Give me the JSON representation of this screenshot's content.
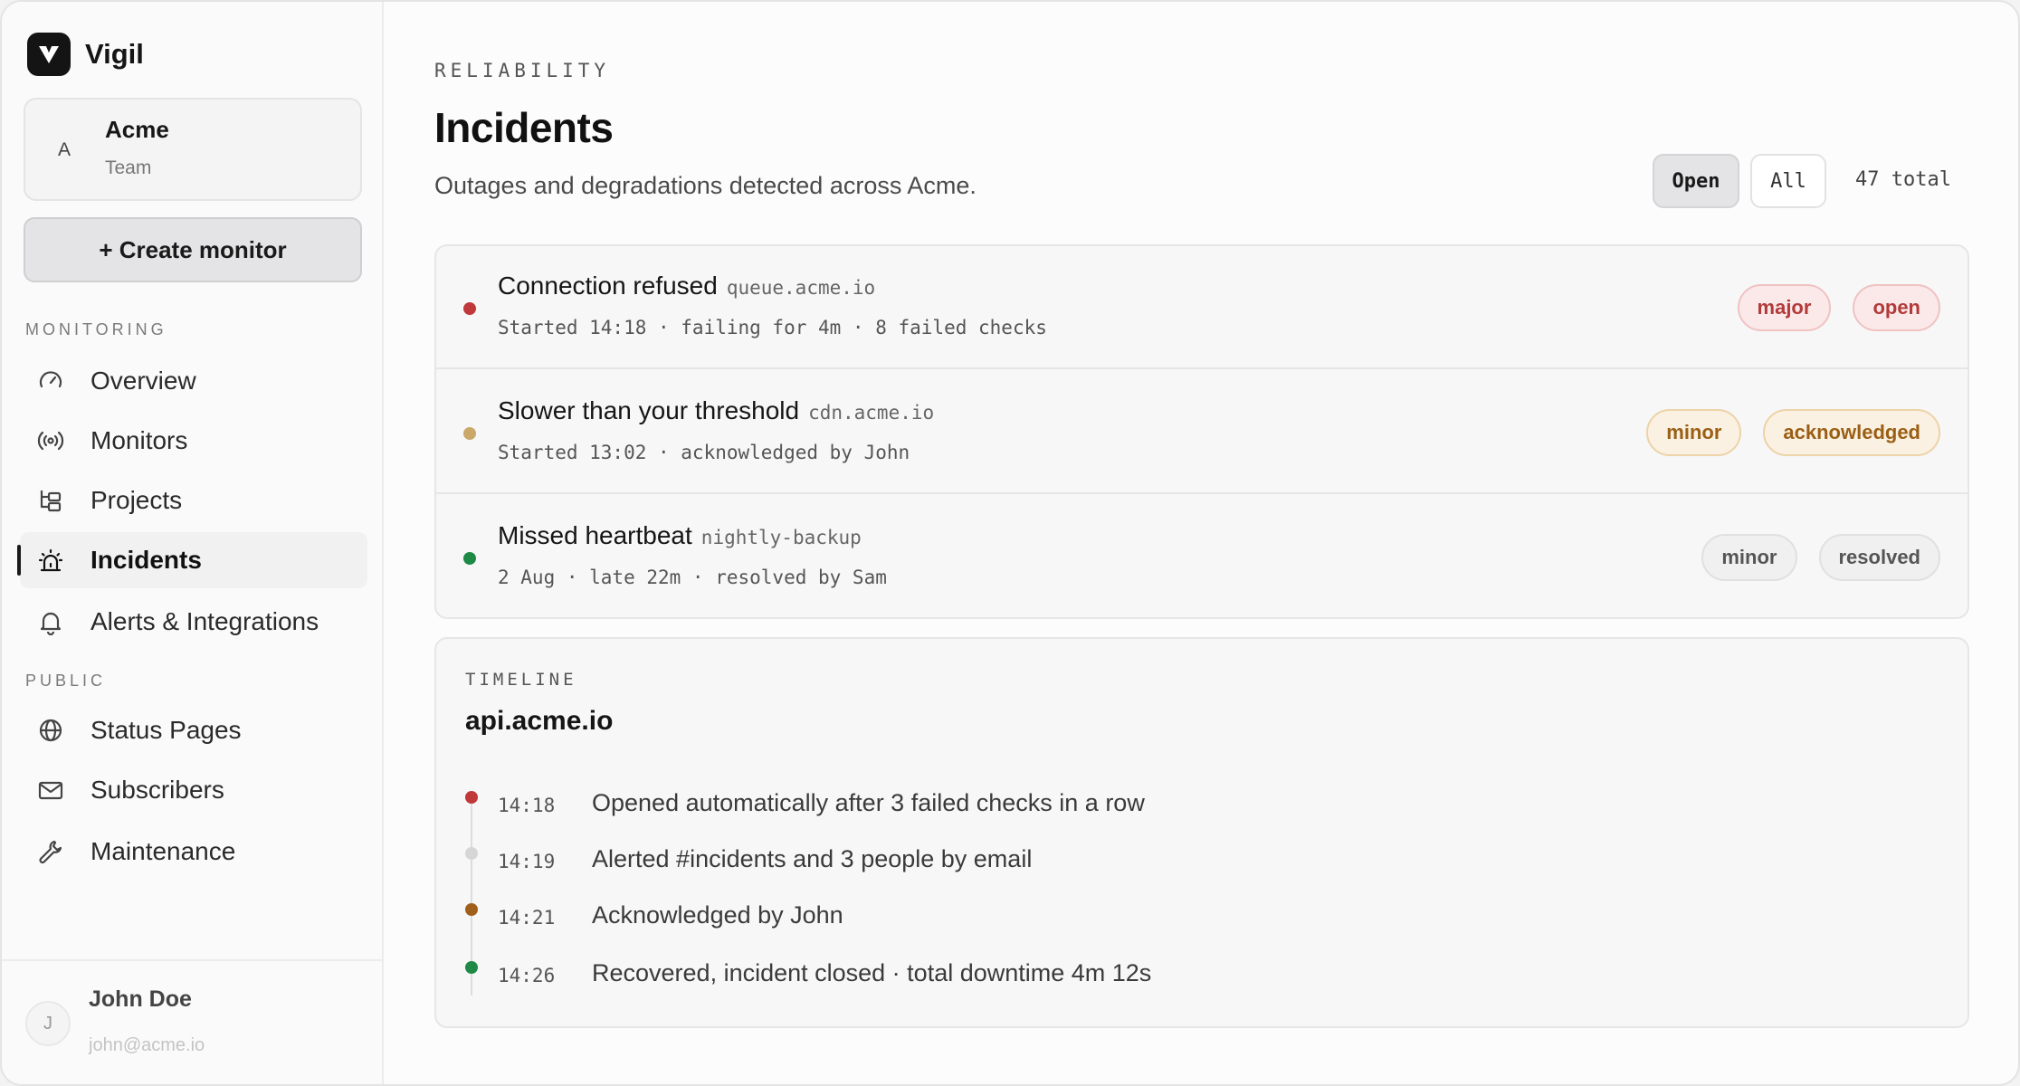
{
  "brand": {
    "name": "Vigil"
  },
  "team": {
    "initial": "A",
    "name": "Acme",
    "role": "Team"
  },
  "sidebar": {
    "create_label": "+ Create monitor",
    "section_monitoring": "MONITORING",
    "section_public": "PUBLIC",
    "monitoring_items": [
      {
        "label": "Overview",
        "icon": "gauge-icon"
      },
      {
        "label": "Monitors",
        "icon": "broadcast-icon"
      },
      {
        "label": "Projects",
        "icon": "folder-tree-icon"
      },
      {
        "label": "Incidents",
        "icon": "siren-icon",
        "active": true
      },
      {
        "label": "Alerts & Integrations",
        "icon": "bell-icon"
      }
    ],
    "public_items": [
      {
        "label": "Status Pages",
        "icon": "globe-icon"
      },
      {
        "label": "Subscribers",
        "icon": "mail-icon"
      },
      {
        "label": "Maintenance",
        "icon": "wrench-icon"
      }
    ]
  },
  "user": {
    "initial": "J",
    "name": "John Doe",
    "email": "john@acme.io"
  },
  "page": {
    "eyebrow": "RELIABILITY",
    "title": "Incidents",
    "subtitle": "Outages and degradations detected across Acme.",
    "filters": {
      "open": "Open",
      "all": "All",
      "active": "Open"
    },
    "total": "47 total"
  },
  "incidents": [
    {
      "title": "Connection refused",
      "host": "queue.acme.io",
      "meta": "Started 14:18 · failing for 4m · 8 failed checks",
      "dot": "#c0383a",
      "severity": "major",
      "status": "open"
    },
    {
      "title": "Slower than your threshold",
      "host": "cdn.acme.io",
      "meta": "Started 13:02 · acknowledged by John",
      "dot": "#c9a86a",
      "severity": "minor",
      "status": "acknowledged"
    },
    {
      "title": "Missed heartbeat",
      "host": "nightly-backup",
      "meta": "2 Aug · late 22m · resolved by Sam",
      "dot": "#1e8a46",
      "severity": "minor",
      "status": "resolved"
    }
  ],
  "timeline": {
    "eyebrow": "TIMELINE",
    "title": "api.acme.io",
    "events": [
      {
        "time": "14:18",
        "text": "Opened automatically after 3 failed checks in a row",
        "dot": "#c0383a"
      },
      {
        "time": "14:19",
        "text": "Alerted #incidents and 3 people by email",
        "dot": "#d6d6d6"
      },
      {
        "time": "14:21",
        "text": "Acknowledged by John",
        "dot": "#a0601c"
      },
      {
        "time": "14:26",
        "text": "Recovered, incident closed · total downtime 4m 12s",
        "dot": "#1e8a46"
      }
    ]
  }
}
